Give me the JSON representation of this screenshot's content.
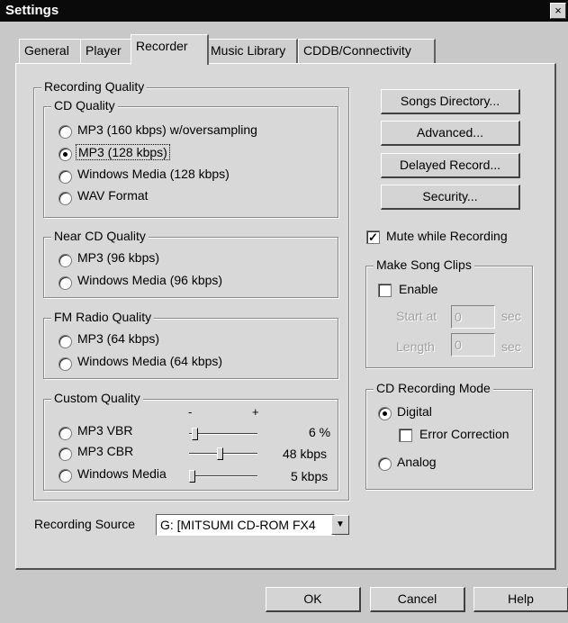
{
  "window": {
    "title": "Settings",
    "close_glyph": "×"
  },
  "tabs": [
    {
      "label": "General"
    },
    {
      "label": "Player"
    },
    {
      "label": "Recorder",
      "active": true
    },
    {
      "label": "Music Library"
    },
    {
      "label": "CDDB/Connectivity"
    }
  ],
  "recording_quality": {
    "label": "Recording Quality",
    "cd_quality": {
      "label": "CD Quality",
      "options": [
        "MP3 (160 kbps) w/oversampling",
        "MP3 (128 kbps)",
        "Windows Media (128 kbps)",
        "WAV Format"
      ],
      "selected": "MP3 (128 kbps)"
    },
    "near_cd_quality": {
      "label": "Near CD Quality",
      "options": [
        "MP3 (96 kbps)",
        "Windows Media (96 kbps)"
      ]
    },
    "fm_radio_quality": {
      "label": "FM Radio Quality",
      "options": [
        "MP3 (64 kbps)",
        "Windows Media (64 kbps)"
      ]
    },
    "custom_quality": {
      "label": "Custom Quality",
      "minus_label": "-",
      "plus_label": "+",
      "rows": [
        {
          "label": "MP3 VBR",
          "value_text": "6 %",
          "level": 0.05
        },
        {
          "label": "MP3 CBR",
          "value_text": "48 kbps",
          "level": 0.45
        },
        {
          "label": "Windows Media",
          "value_text": "5 kbps",
          "level": 0.0
        }
      ]
    }
  },
  "buttons": {
    "songs_directory": "Songs Directory...",
    "advanced": "Advanced...",
    "delayed_record": "Delayed Record...",
    "security": "Security..."
  },
  "mute_while_recording": {
    "label": "Mute while Recording",
    "checked": true
  },
  "song_clips": {
    "label": "Make Song Clips",
    "enable_label": "Enable",
    "enable_checked": false,
    "start_label": "Start at",
    "start_value": "0",
    "length_label": "Length",
    "length_value": "0",
    "unit": "sec"
  },
  "cd_recording_mode": {
    "label": "CD Recording Mode",
    "digital_label": "Digital",
    "error_correction_label": "Error Correction",
    "error_correction_checked": false,
    "analog_label": "Analog",
    "selected": "Digital"
  },
  "recording_source": {
    "label": "Recording Source",
    "value": "G: [MITSUMI CD-ROM FX4"
  },
  "footer": {
    "ok": "OK",
    "cancel": "Cancel",
    "help": "Help"
  },
  "colors": {
    "titlebar": "#0a0a0a",
    "dialog_bg": "#c8c8c8",
    "panel_bg": "#d8d8d8"
  }
}
